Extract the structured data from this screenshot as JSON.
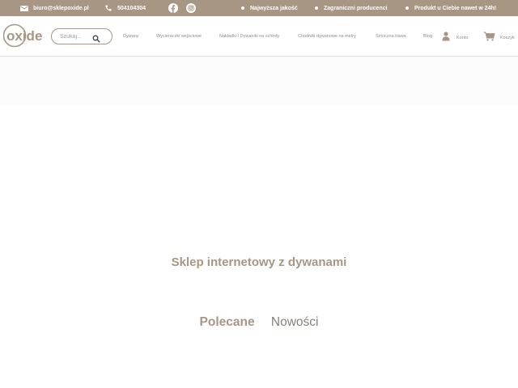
{
  "topbar": {
    "email": "biuro@sklepoxide.pl",
    "phone": "504104304",
    "features": [
      "Najwyższa jakość",
      "Zagraniczni producenci",
      "Produkt u Ciebie nawet w 24h!"
    ],
    "social": [
      "facebook-icon",
      "instagram-icon"
    ]
  },
  "header": {
    "logo_text": "oxide",
    "search": {
      "placeholder": "Szukaj..."
    },
    "nav": [
      "Dywany",
      "Wycieraczki wejściowe",
      "Nakładki / Dywaniki na schody",
      "Chodniki dywanowe na metry",
      "Sztuczna trawa",
      "Blog"
    ],
    "account_label": "Konto",
    "cart_label": "Koszyk"
  },
  "main": {
    "title": "Sklep internetowy z dywanami",
    "tabs": [
      {
        "label": "Polecane",
        "active": true
      },
      {
        "label": "Nowości",
        "active": false
      }
    ]
  },
  "colors": {
    "brand": "#a89684",
    "nav_text": "#8c8c8c",
    "white": "#ffffff"
  }
}
